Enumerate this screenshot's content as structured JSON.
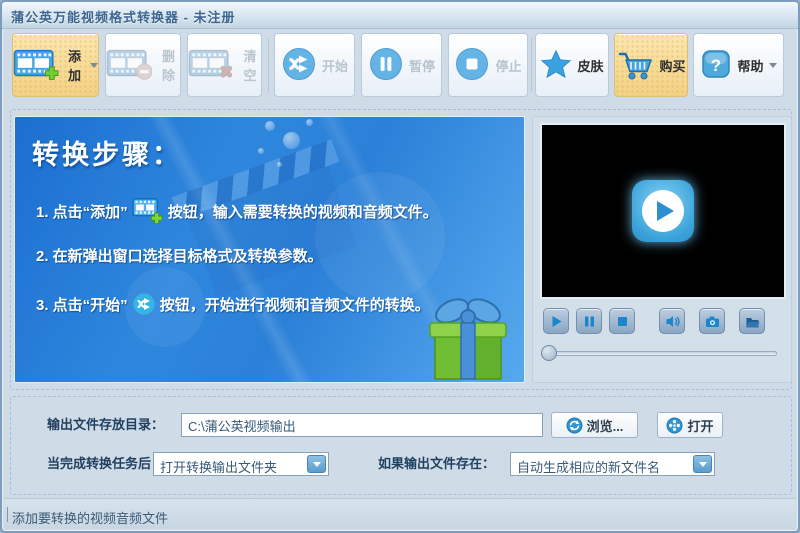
{
  "window": {
    "title": "蒲公英万能视频格式转换器 - 未注册"
  },
  "toolbar": {
    "add_label": "添加",
    "delete_label": "删除",
    "clear_label": "清空",
    "start_label": "开始",
    "pause_label": "暂停",
    "stop_label": "停止",
    "skin_label": "皮肤",
    "buy_label": "购买",
    "help_label": "帮助"
  },
  "instructions": {
    "heading": "转换步骤：",
    "step1_pre": "1. 点击“添加”",
    "step1_post": "按钮，输入需要转换的视频和音频文件。",
    "step2": "2. 在新弹出窗口选择目标格式及转换参数。",
    "step3_pre": "3. 点击“开始”",
    "step3_post": "按钮，开始进行视频和音频文件的转换。"
  },
  "output": {
    "dir_label": "输出文件存放目录：",
    "dir_value": "C:\\蒲公英视频输出",
    "browse_label": "浏览...",
    "open_label": "打开",
    "after_task_label": "当完成转换任务后：",
    "after_task_value": "打开转换输出文件夹",
    "if_exists_label": "如果输出文件存在：",
    "if_exists_value": "自动生成相应的新文件名"
  },
  "statusbar": {
    "text": "添加要转换的视频音频文件"
  },
  "colors": {
    "accent_blue": "#2E9CD6",
    "highlight_orange": "#F6D98F",
    "panel_blue_dark": "#1B6FD0",
    "panel_blue_light": "#57A9EE",
    "video_bg": "#000000",
    "plus_green": "#76CC34"
  }
}
